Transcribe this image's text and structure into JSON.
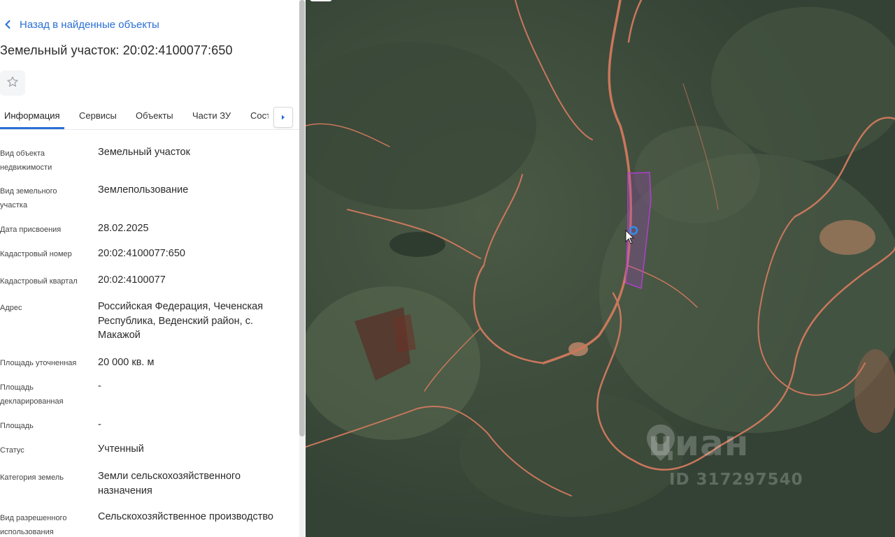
{
  "nav": {
    "back_label": "Назад в найденные объекты"
  },
  "title": "Земельный участок: 20:02:4100077:650",
  "tabs": [
    {
      "label": "Информация",
      "active": true
    },
    {
      "label": "Сервисы"
    },
    {
      "label": "Объекты"
    },
    {
      "label": "Части ЗУ"
    },
    {
      "label": "Соста"
    }
  ],
  "properties": [
    {
      "label": "Вид объекта недвижимости",
      "value": "Земельный участок"
    },
    {
      "label": "Вид земельного участка",
      "value": "Землепользование"
    },
    {
      "label": "Дата присвоения",
      "value": "28.02.2025"
    },
    {
      "label": "Кадастровый номер",
      "value": "20:02:4100077:650"
    },
    {
      "label": "Кадастровый квартал",
      "value": "20:02:4100077"
    },
    {
      "label": "Адрес",
      "value": "Российская Федерация, Чеченская Республика, Веденский район, с. Макажой"
    },
    {
      "label": "Площадь уточненная",
      "value": "20 000 кв. м"
    },
    {
      "label": "Площадь декларированная",
      "value": "-"
    },
    {
      "label": "Площадь",
      "value": "-"
    },
    {
      "label": "Статус",
      "value": "Учтенный"
    },
    {
      "label": "Категория земель",
      "value": "Земли сельскохозяйственного назначения"
    },
    {
      "label": "Вид разрешенного использования",
      "value": "Сельскохозяйственное производство"
    }
  ],
  "map": {
    "watermark_brand": "циан",
    "watermark_id": "ID 317297540",
    "parcel_color": "#b03fd0",
    "marker_color": "#2f8cf0"
  },
  "colors": {
    "accent": "#2a6fd6"
  }
}
